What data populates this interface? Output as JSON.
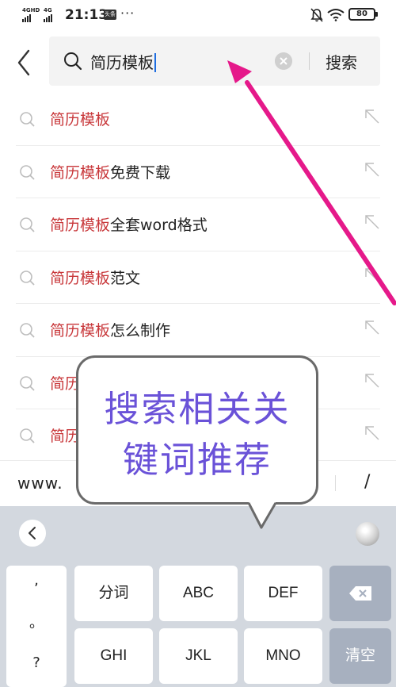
{
  "status_bar": {
    "sim1": "4GHD",
    "sim2": "4G",
    "time": "21:13",
    "app_badge": "头条",
    "dots": "···",
    "battery": "80"
  },
  "search": {
    "query": "简历模板",
    "button_label": "搜索"
  },
  "suggestions": [
    {
      "highlight": "简历模板",
      "rest": ""
    },
    {
      "highlight": "简历模板",
      "rest": "免费下载"
    },
    {
      "highlight": "简历模板",
      "rest": "全套word格式"
    },
    {
      "highlight": "简历模板",
      "rest": "范文"
    },
    {
      "highlight": "简历模板",
      "rest": "怎么制作"
    },
    {
      "highlight": "简历",
      "rest": ""
    },
    {
      "highlight": "简历",
      "rest": ""
    }
  ],
  "url_bar": {
    "prefix": "www.",
    "slash": "/"
  },
  "keyboard": {
    "punct": [
      ",",
      "。",
      "?"
    ],
    "row1": [
      "分词",
      "ABC",
      "DEF"
    ],
    "row2": [
      "GHI",
      "JKL",
      "MNO"
    ],
    "clear_label": "清空"
  },
  "annotation": {
    "line1": "搜索相关关",
    "line2": "键词推荐",
    "arrow_color": "#e5198a",
    "text_color": "#6a52d8"
  }
}
